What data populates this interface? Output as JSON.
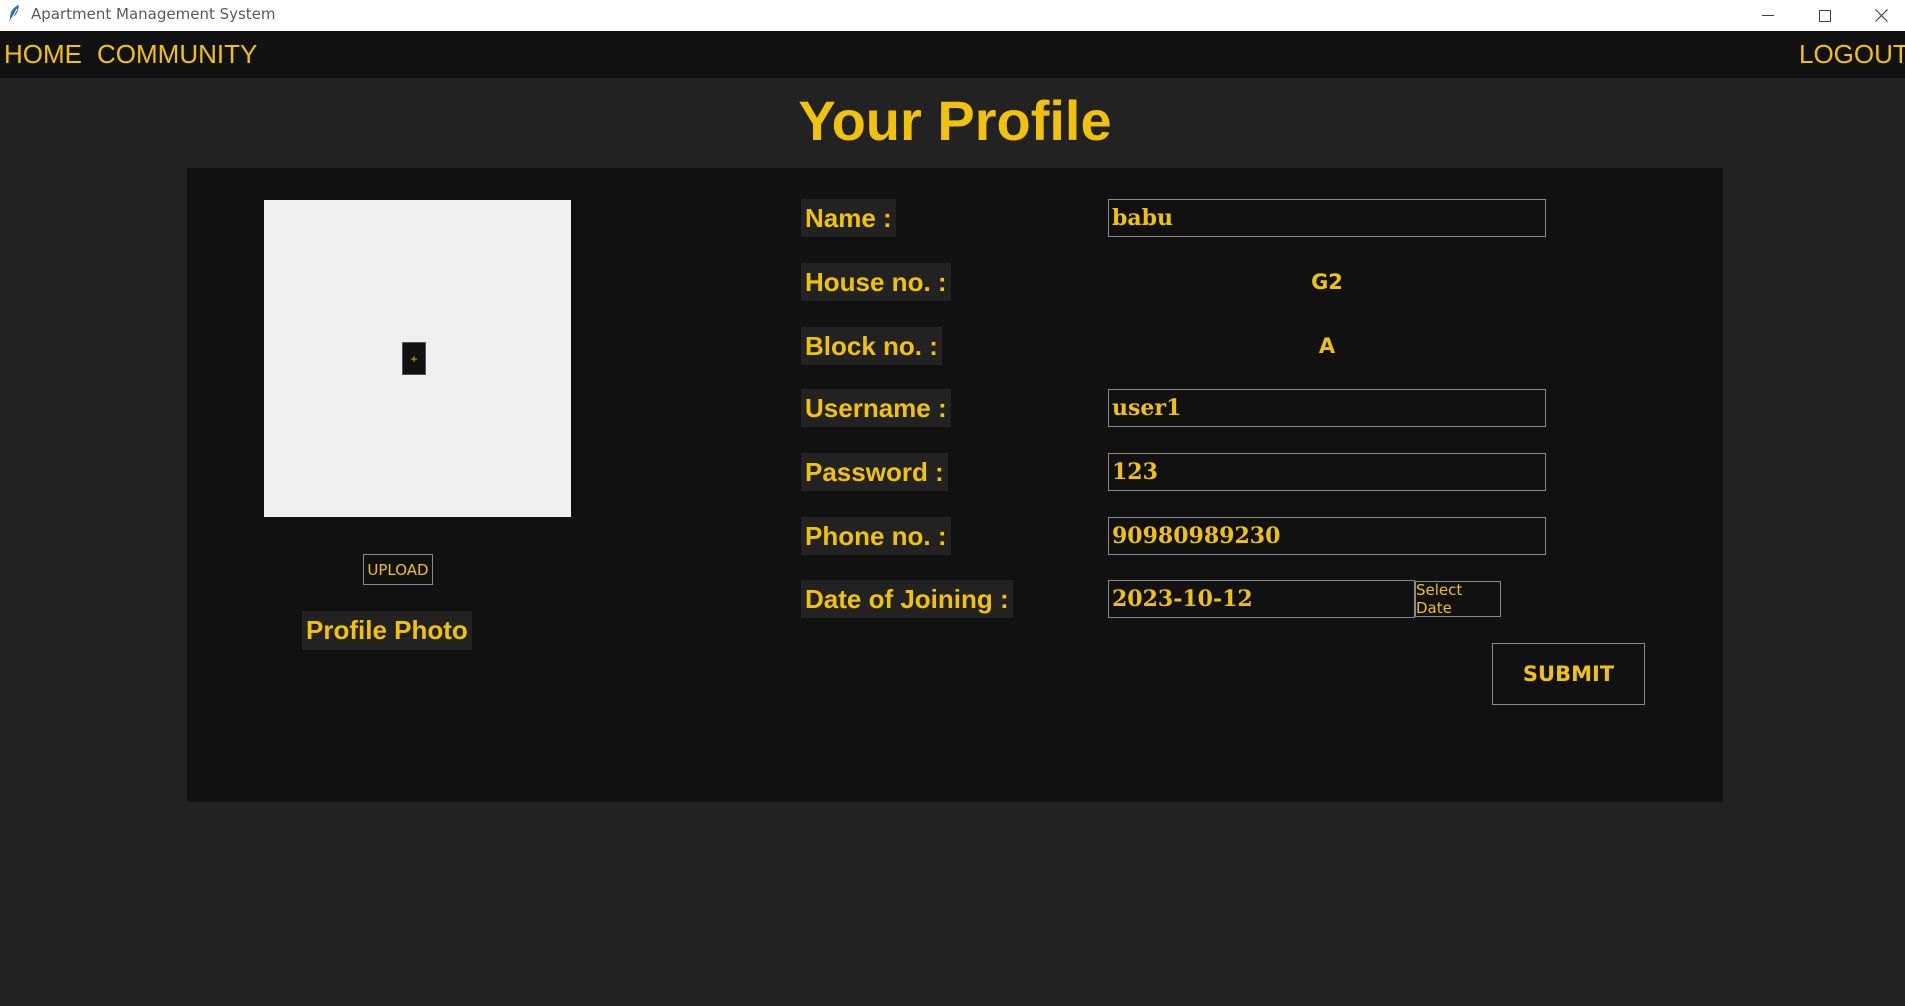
{
  "window": {
    "title": "Apartment Management System",
    "app_icon": "feather-icon"
  },
  "nav": {
    "home": "HOME",
    "community": "COMMUNITY",
    "logout": "LOGOUT"
  },
  "page": {
    "title": "Your Profile"
  },
  "photo": {
    "plus": "+",
    "upload_label": "UPLOAD",
    "caption": "Profile Photo"
  },
  "form": {
    "name_label": "Name :",
    "name_value": "babu",
    "house_label": "House no. :",
    "house_value": "G2",
    "block_label": "Block no. :",
    "block_value": "A",
    "username_label": "Username :",
    "username_value": "user1",
    "password_label": "Password :",
    "password_value": "123",
    "phone_label": "Phone no. :",
    "phone_value": "90980989230",
    "doj_label": "Date of Joining :",
    "doj_value": "2023-10-12",
    "select_date_label": "Select Date",
    "submit_label": "SUBMIT"
  },
  "colors": {
    "accent": "#f0c20b",
    "background": "#222222",
    "panel": "#111111",
    "navbar": "#111111"
  }
}
